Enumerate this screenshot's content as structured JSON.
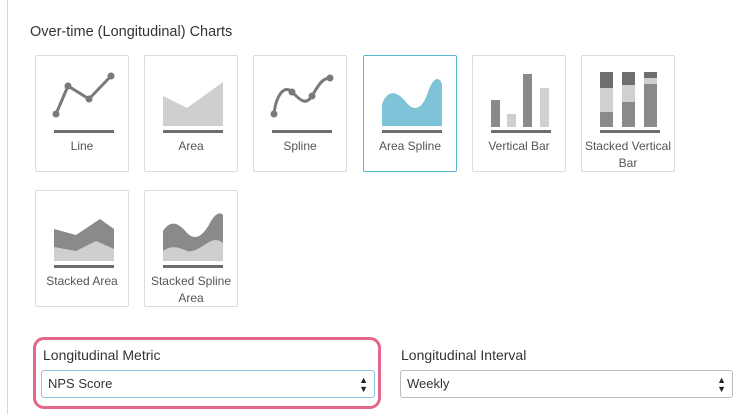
{
  "section_title": "Over-time (Longitudinal) Charts",
  "tiles": [
    {
      "label": "Line",
      "icon": "line-chart-icon"
    },
    {
      "label": "Area",
      "icon": "area-chart-icon"
    },
    {
      "label": "Spline",
      "icon": "spline-chart-icon"
    },
    {
      "label": "Area Spline",
      "icon": "area-spline-chart-icon",
      "selected": true
    },
    {
      "label": "Vertical Bar",
      "icon": "vertical-bar-chart-icon"
    },
    {
      "label": "Stacked Vertical Bar",
      "icon": "stacked-vertical-bar-chart-icon"
    },
    {
      "label": "Stacked Area",
      "icon": "stacked-area-chart-icon"
    },
    {
      "label": "Stacked Spline Area",
      "icon": "stacked-spline-area-chart-icon"
    }
  ],
  "metric": {
    "label": "Longitudinal Metric",
    "value": "NPS Score"
  },
  "interval": {
    "label": "Longitudinal Interval",
    "value": "Weekly"
  },
  "colors": {
    "highlight": "#e5678a",
    "selected_border": "#5bb7cf",
    "accent_fill": "#7fc3d8"
  }
}
